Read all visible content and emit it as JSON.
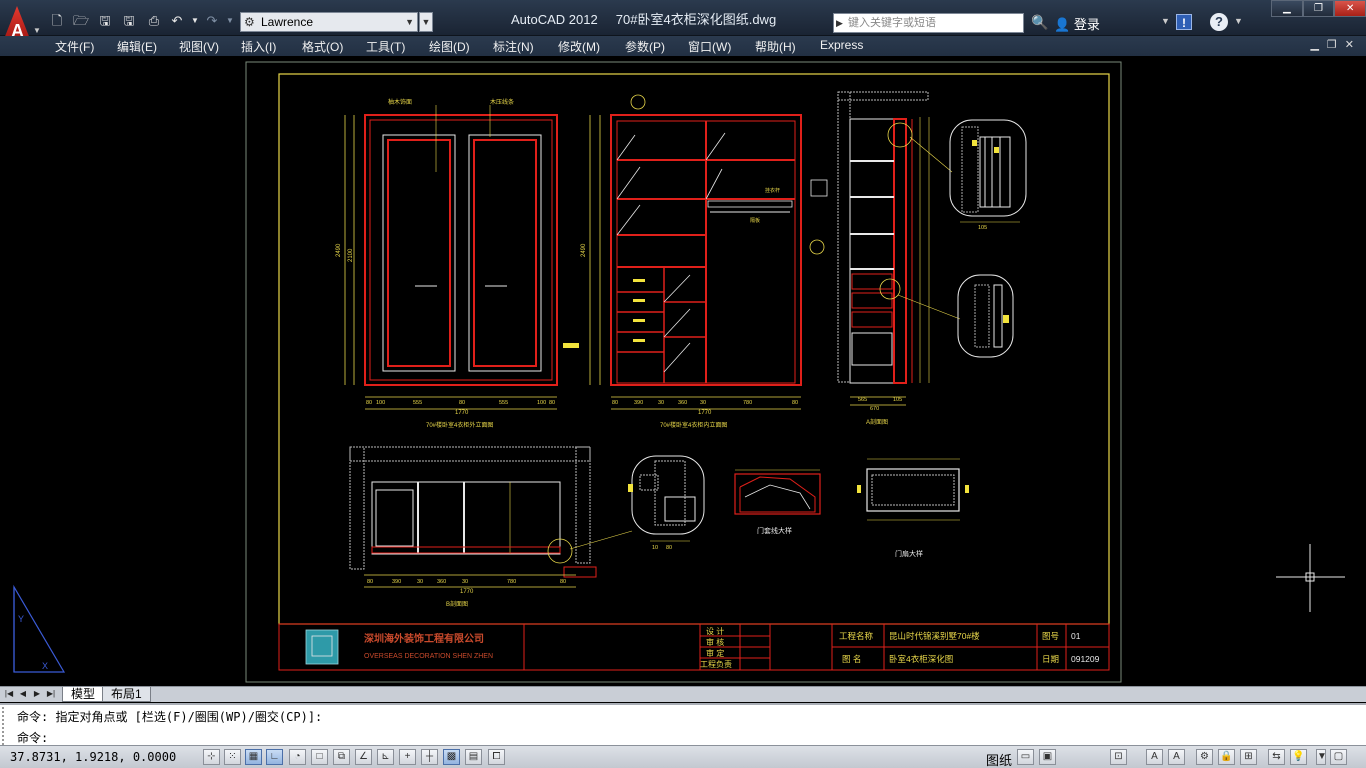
{
  "titlebar": {
    "app_title": "AutoCAD 2012",
    "document_title": "70#卧室4衣柜深化图纸.dwg",
    "workspace": "Lawrence",
    "search_placeholder": "键入关键字或短语",
    "login_label": "登录",
    "exchange_label": "!",
    "help_label": "?",
    "app_letter": "A"
  },
  "menu": {
    "items": [
      "文件(F)",
      "编辑(E)",
      "视图(V)",
      "插入(I)",
      "格式(O)",
      "工具(T)",
      "绘图(D)",
      "标注(N)",
      "修改(M)",
      "参数(P)",
      "窗口(W)",
      "帮助(H)",
      "Express"
    ]
  },
  "drawing": {
    "titles": {
      "front_exterior": "70#楼卧室4衣柜外立面图",
      "front_interior": "70#楼卧室4衣柜内立面图",
      "section": "A剖面图",
      "plan": "B剖面图",
      "door_line_detail": "门套线大样",
      "door_leaf_detail": "门扇大样"
    },
    "labels": {
      "left_top_1": "柚木饰面",
      "left_top_2": "木压线条",
      "hanging_rod": "挂衣杆",
      "shelf": "隔板"
    },
    "dimensions": {
      "total_width_1": "1770",
      "total_width_2": "1770",
      "total_width_3": "1770",
      "height_outer": "2490",
      "height_inner": "2100",
      "segments_1": [
        "80",
        "100",
        "555",
        "80",
        "555",
        "100",
        "80"
      ],
      "segments_2": [
        "80",
        "390",
        "30",
        "360",
        "30",
        "780",
        "80"
      ],
      "segments_plan": [
        "80",
        "390",
        "30",
        "360",
        "30",
        "780",
        "80"
      ],
      "depth": "670",
      "depth_parts": [
        "565",
        "105"
      ],
      "detail_width": "105",
      "detail_parts": [
        "10",
        "80"
      ]
    },
    "title_block": {
      "company_cn": "深圳海外装饰工程有限公司",
      "company_en": "OVERSEAS DECORATION SHEN ZHEN",
      "roles": [
        "设  计",
        "审  核",
        "审  定",
        "工程负责"
      ],
      "project_label": "工程名称",
      "project_value": "昆山时代锦溪别墅70#楼",
      "drawing_label": "图    名",
      "drawing_value": "卧室4衣柜深化图",
      "number_label": "图号",
      "number_value": "01",
      "date_label": "日期",
      "date_value": "091209",
      "logo_text": "OVERSEAS"
    }
  },
  "tabs": {
    "model": "模型",
    "layout": "布局1"
  },
  "command": {
    "history": "命令: 指定对角点或 [栏选(F)/圈围(WP)/圈交(CP)]:",
    "prompt": "命令:"
  },
  "status": {
    "coordinates": "37.8731, 1.9218, 0.0000",
    "paper_label": "图纸"
  },
  "colors": {
    "frame": "#e8d74a",
    "drawing_red": "#e0201a",
    "drawing_white": "#e8e8e8",
    "drawing_yellow": "#f2e33c",
    "ucs": "#3b5bd6"
  }
}
